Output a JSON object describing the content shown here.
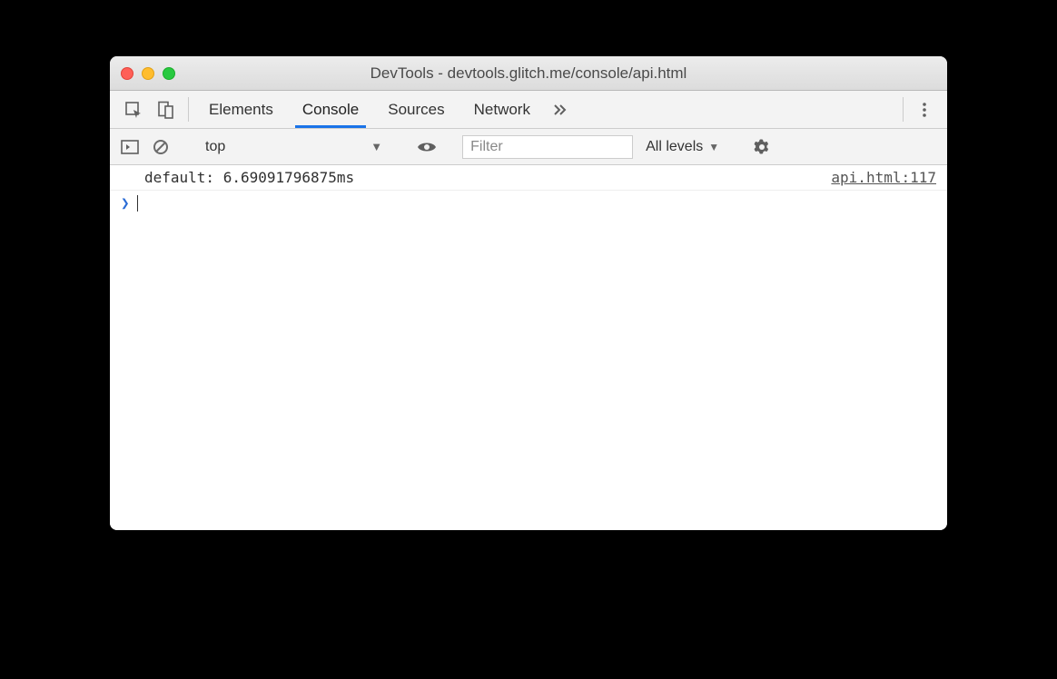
{
  "window": {
    "title": "DevTools - devtools.glitch.me/console/api.html"
  },
  "tabs": {
    "elements": "Elements",
    "console": "Console",
    "sources": "Sources",
    "network": "Network"
  },
  "toolbar": {
    "context": "top",
    "filter_placeholder": "Filter",
    "levels": "All levels"
  },
  "log": {
    "message": "default: 6.69091796875ms",
    "source": "api.html:117"
  }
}
